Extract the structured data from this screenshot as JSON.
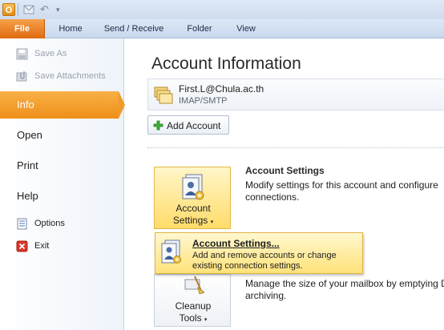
{
  "quick_access": {
    "logo_letter": "O"
  },
  "tabs": [
    "File",
    "Home",
    "Send / Receive",
    "Folder",
    "View"
  ],
  "nav": {
    "save_as": "Save As",
    "save_attachments": "Save Attachments",
    "info": "Info",
    "open": "Open",
    "print": "Print",
    "help": "Help",
    "options": "Options",
    "exit": "Exit"
  },
  "main": {
    "title": "Account Information",
    "account_email": "First.L@Chula.ac.th",
    "account_type": "IMAP/SMTP",
    "add_account": "Add Account",
    "account_settings_btn_line1": "Account",
    "account_settings_btn_line2": "Settings",
    "account_settings_title": "Account Settings",
    "account_settings_desc_1": "Modify settings for this account and configure",
    "account_settings_desc_2": "connections.",
    "cleanup_btn_line1": "Cleanup",
    "cleanup_btn_line2": "Tools",
    "cleanup_desc_1": "Manage the size of your mailbox by emptying D",
    "cleanup_desc_2": "archiving."
  },
  "popup": {
    "title": "Account Settings...",
    "desc_1": "Add and remove accounts or change",
    "desc_2": "existing connection settings."
  },
  "colors": {
    "file_tab": "#e06a10",
    "info_highlight": "#ef8f19",
    "popup_bg": "#ffe27a"
  }
}
